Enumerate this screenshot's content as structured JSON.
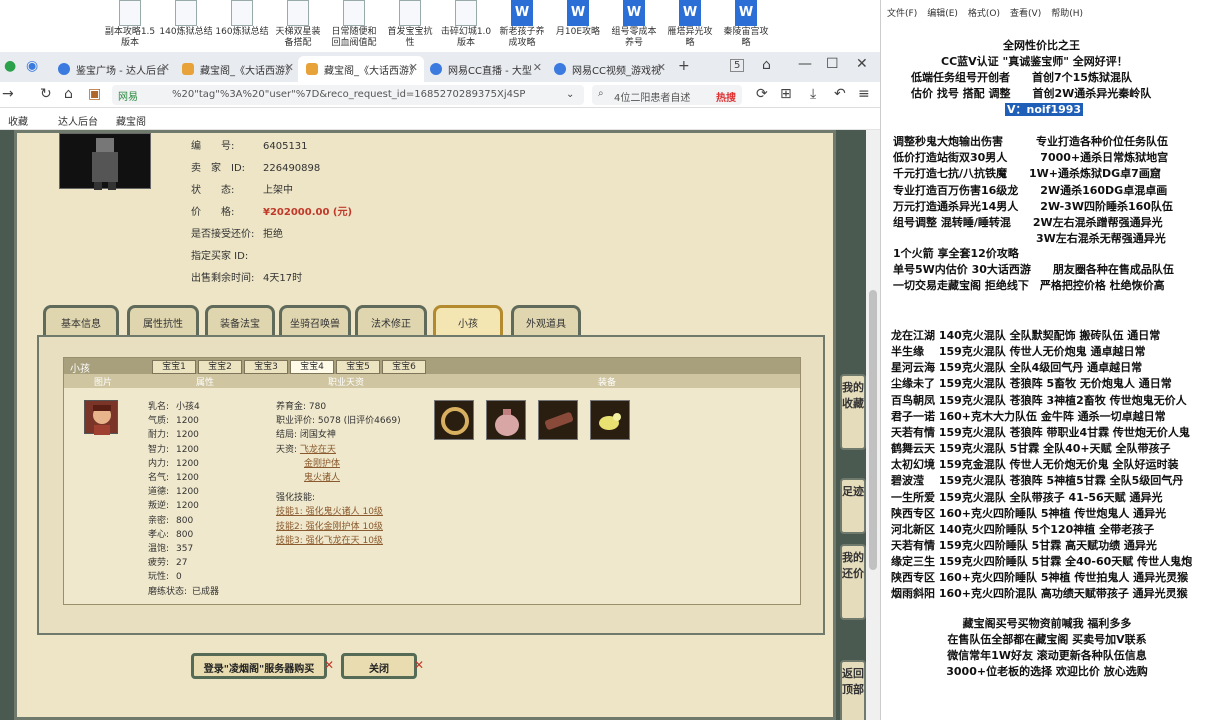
{
  "desktop": {
    "icons": [
      {
        "label": "副本攻略1.5\n版本",
        "type": "doc"
      },
      {
        "label": "140炼狱总结",
        "type": "doc"
      },
      {
        "label": "160炼狱总结",
        "type": "doc"
      },
      {
        "label": "天梯双星装\n备搭配",
        "type": "doc"
      },
      {
        "label": "日常随便和\n回血阀值配",
        "type": "doc"
      },
      {
        "label": "首发宝宝抗\n性",
        "type": "doc"
      },
      {
        "label": "击碎幻城1.0\n版本",
        "type": "doc"
      },
      {
        "label": "新老孩子养\n成攻略",
        "type": "word"
      },
      {
        "label": "月10E攻略",
        "type": "word"
      },
      {
        "label": "组号零成本\n养号",
        "type": "word"
      },
      {
        "label": "雁塔异光攻\n略",
        "type": "word"
      },
      {
        "label": "秦陵宙宫攻\n略",
        "type": "word"
      }
    ]
  },
  "browser": {
    "tabs": [
      {
        "label": "鉴宝广场 - 达人后台",
        "icon": "chat-icon",
        "active": false
      },
      {
        "label": "藏宝阁_《大话西游》",
        "icon": "treasure-icon",
        "active": false
      },
      {
        "label": "藏宝阁_《大话西游》",
        "icon": "treasure-icon",
        "active": true
      },
      {
        "label": "网易CC直播 - 大型",
        "icon": "cc-icon",
        "active": false
      },
      {
        "label": "网易CC视频_游戏视",
        "icon": "cc-icon",
        "active": false
      }
    ],
    "tab_counter": "5",
    "site_label": "网易",
    "url": "%20\"tag\"%3A%20\"user\"%7D&reco_request_id=1685270289375Xj4SP",
    "search_text": "4位二阳患者自述",
    "search_hot": "热搜",
    "bookmarks": [
      "收藏",
      "达人后台",
      "藏宝阁"
    ]
  },
  "listing": {
    "rows": [
      {
        "k": "编　　号:",
        "v": "6405131"
      },
      {
        "k": "卖　家　ID:",
        "v": "226490898"
      },
      {
        "k": "状　　态:",
        "v": "上架中"
      },
      {
        "k": "价　　格:",
        "v": "¥202000.00 (元)"
      },
      {
        "k": "是否接受还价:",
        "v": "拒绝"
      },
      {
        "k": "指定买家 ID:",
        "v": ""
      },
      {
        "k": "出售剩余时间:",
        "v": "4天17时"
      }
    ]
  },
  "panel_tabs": [
    "基本信息",
    "属性抗性",
    "装备法宝",
    "坐骑召唤兽",
    "法术修正",
    "小孩",
    "外观道具"
  ],
  "child": {
    "header": "小孩",
    "baby_tabs": [
      "宝宝1",
      "宝宝2",
      "宝宝3",
      "宝宝4",
      "宝宝5",
      "宝宝6"
    ],
    "columns": [
      "图片",
      "属性",
      "职业天资",
      "装备"
    ],
    "attrs": [
      {
        "k": "乳名:",
        "v": "小孩4"
      },
      {
        "k": "气质:",
        "v": "1200"
      },
      {
        "k": "耐力:",
        "v": "1200"
      },
      {
        "k": "智力:",
        "v": "1200"
      },
      {
        "k": "内力:",
        "v": "1200"
      },
      {
        "k": "名气:",
        "v": "1200"
      },
      {
        "k": "道德:",
        "v": "1200"
      },
      {
        "k": "叛逆:",
        "v": "1200"
      },
      {
        "k": "亲密:",
        "v": "800"
      },
      {
        "k": "孝心:",
        "v": "800"
      },
      {
        "k": "温饱:",
        "v": "357"
      },
      {
        "k": "疲劳:",
        "v": "27"
      },
      {
        "k": "玩性:",
        "v": "0"
      },
      {
        "k": "磨练状态:",
        "v": "已成器"
      }
    ],
    "job": {
      "fund": "养育金: 780",
      "score": "职业评价: 5078 (旧评价4669)",
      "ending": "结局: 闭国女神",
      "talent_label": "天资:",
      "talents": [
        "飞龙在天",
        "金刚护体",
        "鬼火诸人"
      ],
      "skill_label": "强化技能:",
      "skills": [
        "技能1: 强化鬼火诸人 10级",
        "技能2: 强化金刚护体 10级",
        "技能3: 强化飞龙在天 10级"
      ]
    },
    "equip_icons": [
      "bracelet-icon",
      "pouch-icon",
      "scroll-icon",
      "gem-icon"
    ]
  },
  "buttons": {
    "buy": "登录\"凌烟阁\"服务器购买",
    "close": "关闭"
  },
  "side_buttons": [
    "我的收藏",
    "足迹",
    "我的还价",
    "返回顶部"
  ],
  "notepad": {
    "menu": [
      "文件(F)",
      "编辑(E)",
      "格式(O)",
      "查看(V)",
      "帮助(H)"
    ],
    "lines_top": [
      "全网性价比之王",
      "CC蓝V认证 \"真诚鉴宝师\" 全网好评！",
      "低端任务组号开创者　　首创7个15炼狱混队",
      "估价 找号 搭配 调整　　首创2W通杀异光秦岭队"
    ],
    "contact": "V：noif1993",
    "block1": [
      "调整秒鬼大炮输出伤害　　　专业打造各种价位任务队伍",
      "低价打造站街双30男人　　　7000+通杀日常炼狱地宫",
      "千元打造七抗/八抗铁魔　　1W+通杀炼狱DG卓7画窟",
      "专业打造百万伤害16级龙　　2W通杀160DG卓混卓画",
      "万元打造通杀异光14男人　　2W-3W四阶睡杀160队伍",
      "组号调整 混转睡/睡转混　　2W左右混杀蹭帮强通异光",
      "　　　　　　　　　　　　　3W左右混杀无帮强通异光"
    ],
    "block2": [
      "1个火箭 享全套12价攻略",
      "单号5W内估价 30大话西游　　朋友圈各种在售成品队伍",
      "一切交易走藏宝阁 拒绝线下　严格把控价格 杜绝恢价高"
    ],
    "block3": [
      "龙在江湖 140克火混队 全队默契配饰 搬砖队伍 通日常",
      "半生缘　 159克火混队 传世人无价炮鬼 通卓越日常",
      "星河云海 159克火混队 全队4级回气丹 通卓越日常",
      "尘缘未了 159克火混队 苍狼阵 5畜牧 无价炮鬼人 通日常",
      "百鸟朝凤 159克火混队 苍狼阵 3神植2畜牧 传世炮鬼无价人",
      "君子一诺 160+克木大力队伍 金牛阵 通杀一切卓越日常",
      "天若有情 159克火混队 苍狼阵 带职业4甘霖 传世炮无价人鬼",
      "鹤舞云天 159克火混队 5甘霖 全队40+天赋 全队带孩子",
      "太初幻境 159克金混队 传世人无价炮无价鬼 全队好运时装",
      "碧波滢　 159克火混队 苍狼阵 5神植5甘霖 全队5级回气丹",
      "一生所爱 159克火混队 全队带孩子 41-56天赋 通异光",
      "陕西专区 160+克火四阶睡队 5神植 传世炮鬼人 通异光",
      "河北新区 140克火四阶睡队 5个120神植 全带老孩子",
      "天若有情 159克火四阶睡队 5甘霖 高天赋功绩 通异光",
      "缘定三生 159克火四阶睡队 5甘霖 全40-60天赋 传世人鬼炮",
      "陕西专区 160+克火四阶睡队 5神植 传世拍鬼人 通异光灵猴",
      "烟雨斜阳 160+克火四阶混队 高功绩天赋带孩子 通异光灵猴"
    ],
    "block4": [
      "藏宝阁买号买物资前喊我 福利多多",
      "在售队伍全部都在藏宝阁 买卖号加V联系",
      "微信常年1W好友 滚动更新各种队伍信息",
      "3000+位老板的选择 欢迎比价 放心选购"
    ]
  }
}
